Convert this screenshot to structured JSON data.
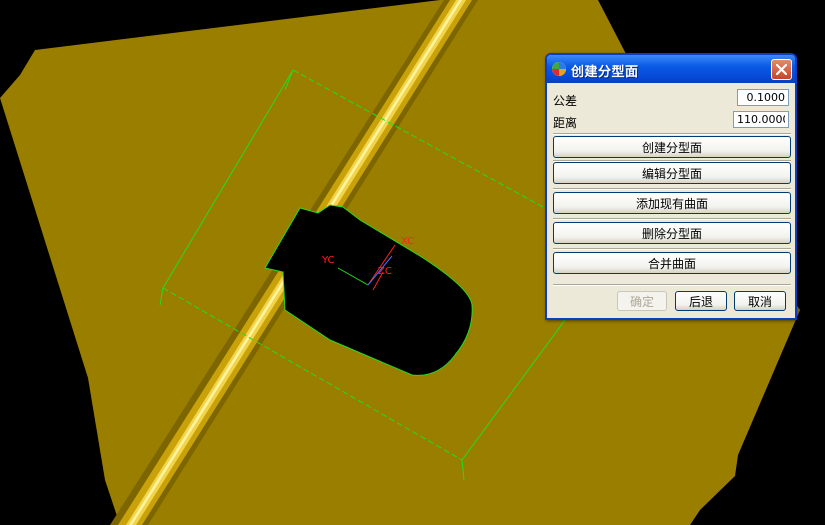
{
  "viewport": {
    "axis_labels": {
      "xc": "XC",
      "yc": "YC",
      "zc": "ZC"
    },
    "colors": {
      "surface": "#9a7e00",
      "ridge": "#d4ad10",
      "wireframe": "#22dd22",
      "triad": "#ff2020",
      "background": "#000000"
    }
  },
  "dialog": {
    "title": "创建分型面",
    "icons": {
      "app": "nx-app-icon",
      "close": "close-icon"
    },
    "tolerance": {
      "label": "公差",
      "value": "0.1000"
    },
    "distance": {
      "label": "距离",
      "value": "110.0000"
    },
    "buttons": {
      "create": "创建分型面",
      "edit": "编辑分型面",
      "add_existing": "添加现有曲面",
      "delete": "删除分型面",
      "merge": "合并曲面"
    },
    "footer": {
      "ok": "确定",
      "back": "后退",
      "cancel": "取消"
    }
  }
}
